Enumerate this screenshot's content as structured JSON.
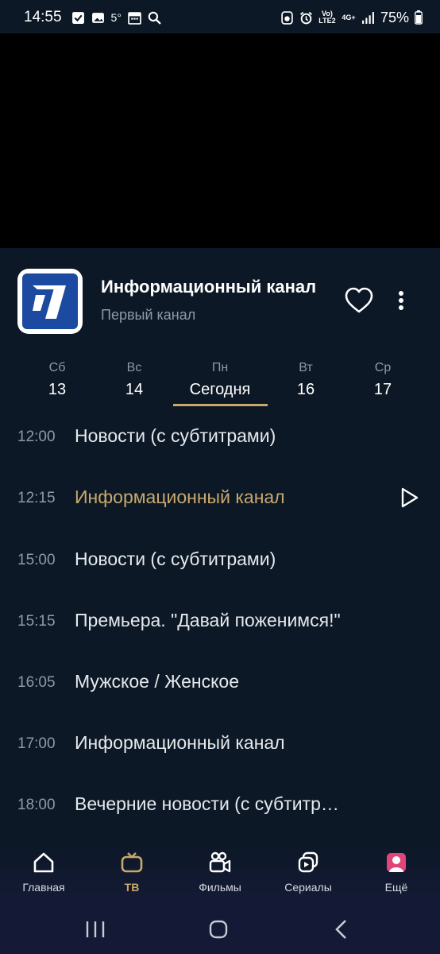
{
  "status_bar": {
    "time": "14:55",
    "temperature": "5°",
    "network_top": "Vo) LTE2",
    "network_gen": "4G+",
    "battery": "75%"
  },
  "channel": {
    "program_title": "Информационный канал",
    "channel_name": "Первый канал"
  },
  "days": [
    {
      "weekday": "Сб",
      "label": "13"
    },
    {
      "weekday": "Вс",
      "label": "14"
    },
    {
      "weekday": "Пн",
      "label": "Сегодня"
    },
    {
      "weekday": "Вт",
      "label": "16"
    },
    {
      "weekday": "Ср",
      "label": "17"
    }
  ],
  "schedule": [
    {
      "time": "12:00",
      "title": "Новости (с субтитрами)"
    },
    {
      "time": "12:15",
      "title": "Информационный канал"
    },
    {
      "time": "15:00",
      "title": "Новости (с субтитрами)"
    },
    {
      "time": "15:15",
      "title": "Премьера. \"Давай поженимся!\""
    },
    {
      "time": "16:05",
      "title": "Мужское / Женское"
    },
    {
      "time": "17:00",
      "title": "Информационный канал"
    },
    {
      "time": "18:00",
      "title": "Вечерние новости (с субтитр…"
    }
  ],
  "bottom_nav": [
    {
      "label": "Главная",
      "icon": "home-icon"
    },
    {
      "label": "ТВ",
      "icon": "tv-icon"
    },
    {
      "label": "Фильмы",
      "icon": "movie-camera-icon"
    },
    {
      "label": "Сериалы",
      "icon": "series-icon"
    },
    {
      "label": "Ещё",
      "icon": "profile-icon"
    }
  ],
  "colors": {
    "background": "#0c1826",
    "accent_gold": "#c9a96b",
    "muted_text": "#8f9aa8",
    "logo_blue": "#1b4aa0",
    "profile_pink": "#e0457a"
  }
}
